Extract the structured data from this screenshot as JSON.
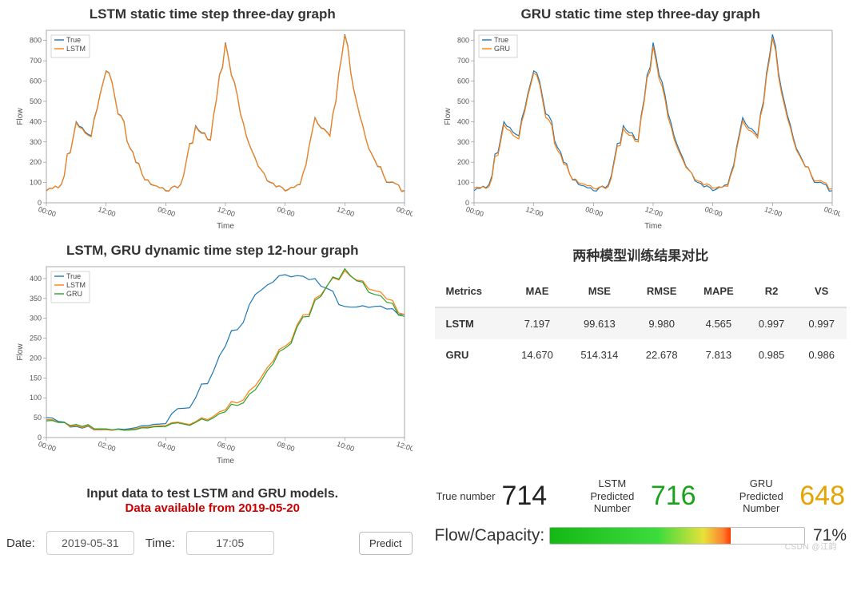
{
  "chart_data": [
    {
      "id": "lstm3",
      "type": "line",
      "title": "LSTM static time step three-day graph",
      "xlabel": "Time",
      "ylabel": "Flow",
      "x_ticks": [
        "00:00",
        "12:00",
        "00:00",
        "12:00",
        "00:00",
        "12:00",
        "00:00"
      ],
      "ylim": [
        0,
        850
      ],
      "legend": [
        "True",
        "LSTM"
      ],
      "x": [
        0,
        3,
        6,
        9,
        12,
        15,
        18,
        21,
        24,
        27,
        30,
        33,
        36,
        39,
        42,
        45,
        48,
        51,
        54,
        57,
        60,
        63,
        66,
        69,
        72
      ],
      "series": [
        {
          "name": "True",
          "color": "#1f77b4",
          "values": [
            60,
            90,
            400,
            330,
            650,
            430,
            200,
            90,
            60,
            90,
            380,
            310,
            790,
            440,
            220,
            100,
            60,
            90,
            420,
            330,
            830,
            430,
            210,
            100,
            60
          ]
        },
        {
          "name": "LSTM",
          "color": "#ff7f0e",
          "values": [
            58,
            92,
            395,
            325,
            648,
            428,
            198,
            92,
            58,
            92,
            376,
            308,
            786,
            438,
            218,
            102,
            58,
            92,
            418,
            328,
            826,
            428,
            212,
            102,
            58
          ]
        }
      ]
    },
    {
      "id": "gru3",
      "type": "line",
      "title": "GRU static time step three-day graph",
      "xlabel": "Time",
      "ylabel": "Flow",
      "x_ticks": [
        "00:00",
        "12:00",
        "00:00",
        "12:00",
        "00:00",
        "12:00",
        "00:00"
      ],
      "ylim": [
        0,
        850
      ],
      "legend": [
        "True",
        "GRU"
      ],
      "x": [
        0,
        3,
        6,
        9,
        12,
        15,
        18,
        21,
        24,
        27,
        30,
        33,
        36,
        39,
        42,
        45,
        48,
        51,
        54,
        57,
        60,
        63,
        66,
        69,
        72
      ],
      "series": [
        {
          "name": "True",
          "color": "#1f77b4",
          "values": [
            60,
            90,
            400,
            330,
            650,
            430,
            200,
            90,
            60,
            90,
            380,
            310,
            790,
            440,
            220,
            100,
            60,
            90,
            420,
            330,
            830,
            430,
            210,
            100,
            60
          ]
        },
        {
          "name": "GRU",
          "color": "#ff7f0e",
          "values": [
            72,
            80,
            385,
            315,
            640,
            410,
            190,
            98,
            72,
            80,
            365,
            300,
            770,
            420,
            210,
            108,
            72,
            82,
            405,
            320,
            810,
            415,
            205,
            108,
            70
          ]
        }
      ]
    },
    {
      "id": "dyn12",
      "type": "line",
      "title": "LSTM, GRU dynamic time step 12-hour graph",
      "xlabel": "Time",
      "ylabel": "Flow",
      "x_ticks": [
        "00:00",
        "02:00",
        "04:00",
        "06:00",
        "08:00",
        "10:00",
        "12:00"
      ],
      "ylim": [
        0,
        430
      ],
      "legend": [
        "True",
        "LSTM",
        "GRU"
      ],
      "x": [
        0,
        1,
        2,
        3,
        4,
        5,
        6,
        7,
        8,
        9,
        10,
        11,
        12
      ],
      "series": [
        {
          "name": "True",
          "color": "#1f77b4",
          "values": [
            50,
            28,
            20,
            25,
            35,
            100,
            230,
            360,
            410,
            400,
            330,
            330,
            310
          ]
        },
        {
          "name": "LSTM",
          "color": "#ff7f0e",
          "values": [
            45,
            30,
            20,
            22,
            30,
            40,
            70,
            130,
            230,
            350,
            420,
            370,
            310
          ]
        },
        {
          "name": "GRU",
          "color": "#2ca02c",
          "values": [
            42,
            33,
            22,
            20,
            28,
            38,
            65,
            120,
            225,
            345,
            425,
            360,
            305
          ]
        }
      ]
    }
  ],
  "metrics_table": {
    "title": "两种模型训练结果对比",
    "columns": [
      "Metrics",
      "MAE",
      "MSE",
      "RMSE",
      "MAPE",
      "R2",
      "VS"
    ],
    "rows": [
      {
        "model": "LSTM",
        "values": [
          "7.197",
          "99.613",
          "9.980",
          "4.565",
          "0.997",
          "0.997"
        ]
      },
      {
        "model": "GRU",
        "values": [
          "14.670",
          "514.314",
          "22.678",
          "7.813",
          "0.985",
          "0.986"
        ]
      }
    ]
  },
  "form": {
    "title_line1": "Input data to test LSTM and GRU models.",
    "title_line2": "Data available from 2019-05-20",
    "date_label": "Date:",
    "date_value": "2019-05-31",
    "time_label": "Time:",
    "time_value": "17:05",
    "predict_label": "Predict"
  },
  "results": {
    "true_number_label": "True number",
    "true_number_value": "714",
    "lstm_pred_label": "LSTM Predicted Number",
    "lstm_pred_value": "716",
    "gru_pred_label": "GRU Predicted Number",
    "gru_pred_value": "648",
    "flow_label": "Flow/Capacity:",
    "flow_pct": "71%",
    "flow_pct_num": 71
  },
  "watermark": "CSDN @江韵"
}
